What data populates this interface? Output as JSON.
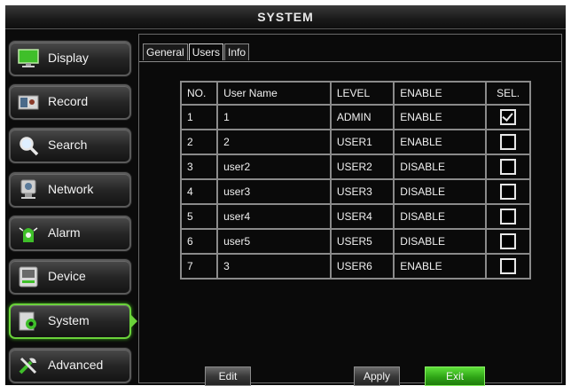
{
  "window": {
    "title": "SYSTEM"
  },
  "sidebar": {
    "items": [
      {
        "label": "Display",
        "icon": "display-icon",
        "active": false
      },
      {
        "label": "Record",
        "icon": "record-icon",
        "active": false
      },
      {
        "label": "Search",
        "icon": "search-icon",
        "active": false
      },
      {
        "label": "Network",
        "icon": "network-icon",
        "active": false
      },
      {
        "label": "Alarm",
        "icon": "alarm-icon",
        "active": false
      },
      {
        "label": "Device",
        "icon": "device-icon",
        "active": false
      },
      {
        "label": "System",
        "icon": "system-icon",
        "active": true
      },
      {
        "label": "Advanced",
        "icon": "advanced-icon",
        "active": false
      }
    ]
  },
  "tabs": [
    {
      "label": "General",
      "active": false
    },
    {
      "label": "Users",
      "active": true
    },
    {
      "label": "Info",
      "active": false
    }
  ],
  "table": {
    "headers": [
      "NO.",
      "User Name",
      "LEVEL",
      "ENABLE",
      "SEL."
    ],
    "rows": [
      {
        "no": "1",
        "name": "1",
        "level": "ADMIN",
        "enable": "ENABLE",
        "selected": true
      },
      {
        "no": "2",
        "name": "2",
        "level": "USER1",
        "enable": "ENABLE",
        "selected": false
      },
      {
        "no": "3",
        "name": "user2",
        "level": "USER2",
        "enable": "DISABLE",
        "selected": false
      },
      {
        "no": "4",
        "name": "user3",
        "level": "USER3",
        "enable": "DISABLE",
        "selected": false
      },
      {
        "no": "5",
        "name": "user4",
        "level": "USER4",
        "enable": "DISABLE",
        "selected": false
      },
      {
        "no": "6",
        "name": "user5",
        "level": "USER5",
        "enable": "DISABLE",
        "selected": false
      },
      {
        "no": "7",
        "name": "3",
        "level": "USER6",
        "enable": "ENABLE",
        "selected": false
      }
    ]
  },
  "buttons": {
    "edit": "Edit",
    "apply": "Apply",
    "exit": "Exit"
  },
  "colors": {
    "accent_green": "#6ad23a",
    "exit_button": "#2fa516",
    "background": "#0b0b0b"
  }
}
